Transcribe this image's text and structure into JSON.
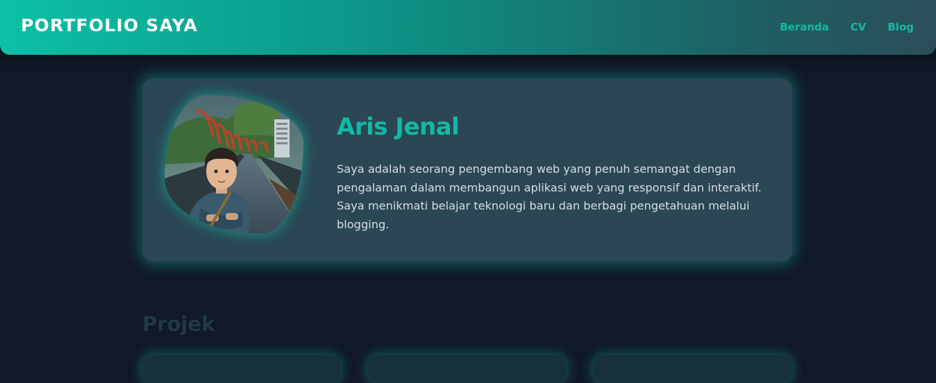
{
  "header": {
    "brand": "PORTFOLIO SAYA",
    "nav": [
      "Beranda",
      "CV",
      "Blog"
    ]
  },
  "profile": {
    "name": "Aris Jenal",
    "bio": "Saya adalah seorang pengembang web yang penuh semangat dengan pengalaman dalam membangun aplikasi web yang responsif dan interaktif. Saya menikmati belajar teknologi baru dan berbagi pengetahuan melalui blogging.",
    "avatar_icon": "avatar-illustration"
  },
  "projects": {
    "title": "Projek"
  },
  "colors": {
    "accent": "#14b8a6",
    "background": "#111827",
    "card": "#2a4753"
  }
}
